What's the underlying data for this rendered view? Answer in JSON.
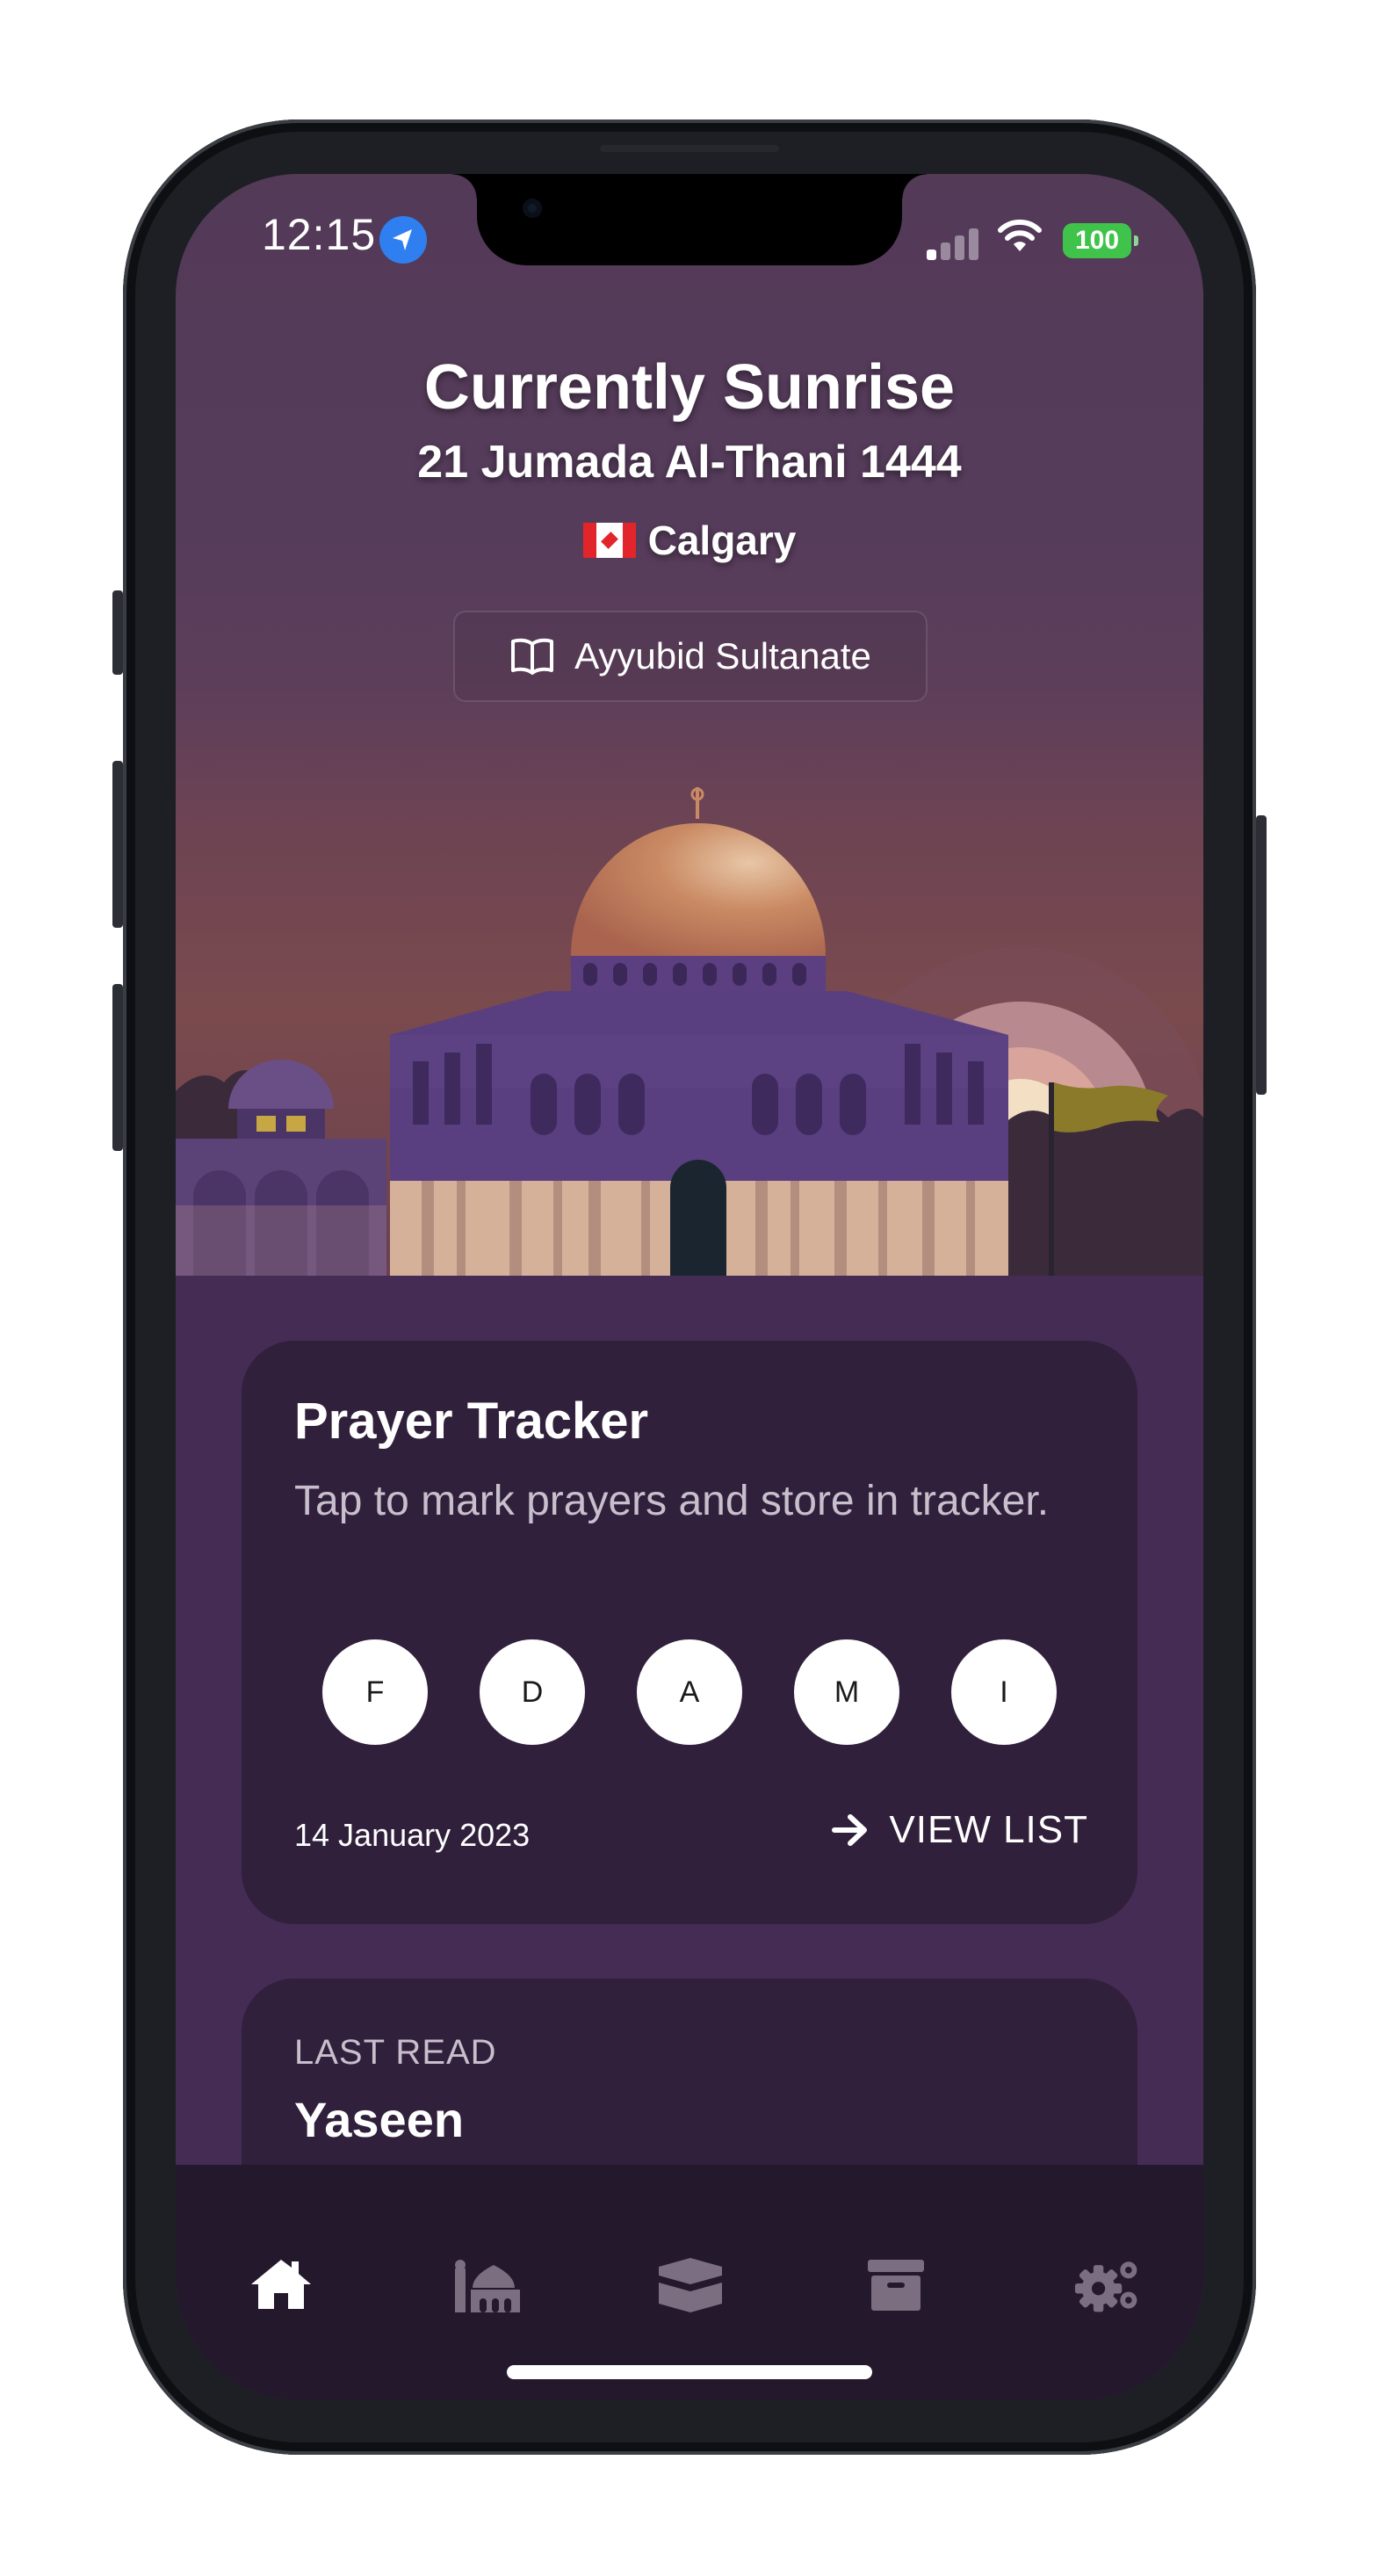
{
  "status_bar": {
    "time": "12:15",
    "battery": "100"
  },
  "header": {
    "title": "Currently Sunrise",
    "hijri_date": "21 Jumada Al-Thani 1444",
    "city": "Calgary",
    "era_button_label": "Ayyubid Sultanate"
  },
  "prayer_tracker": {
    "title": "Prayer Tracker",
    "subtitle": "Tap to mark prayers and store in tracker.",
    "prayers": [
      "F",
      "D",
      "A",
      "M",
      "I"
    ],
    "date": "14 January 2023",
    "view_list_label": "VIEW LIST"
  },
  "last_read": {
    "label": "LAST READ",
    "surah": "Yaseen"
  },
  "tab_bar": {
    "items": [
      "home-icon",
      "mosque-icon",
      "kaaba-icon",
      "archive-icon",
      "settings-icon"
    ],
    "active_index": 0
  },
  "colors": {
    "background": "#442c55",
    "card": "#30203b",
    "tab_bar": "#23182c",
    "accent_battery": "#3fc34b",
    "location_blue": "#2f7ff0"
  }
}
